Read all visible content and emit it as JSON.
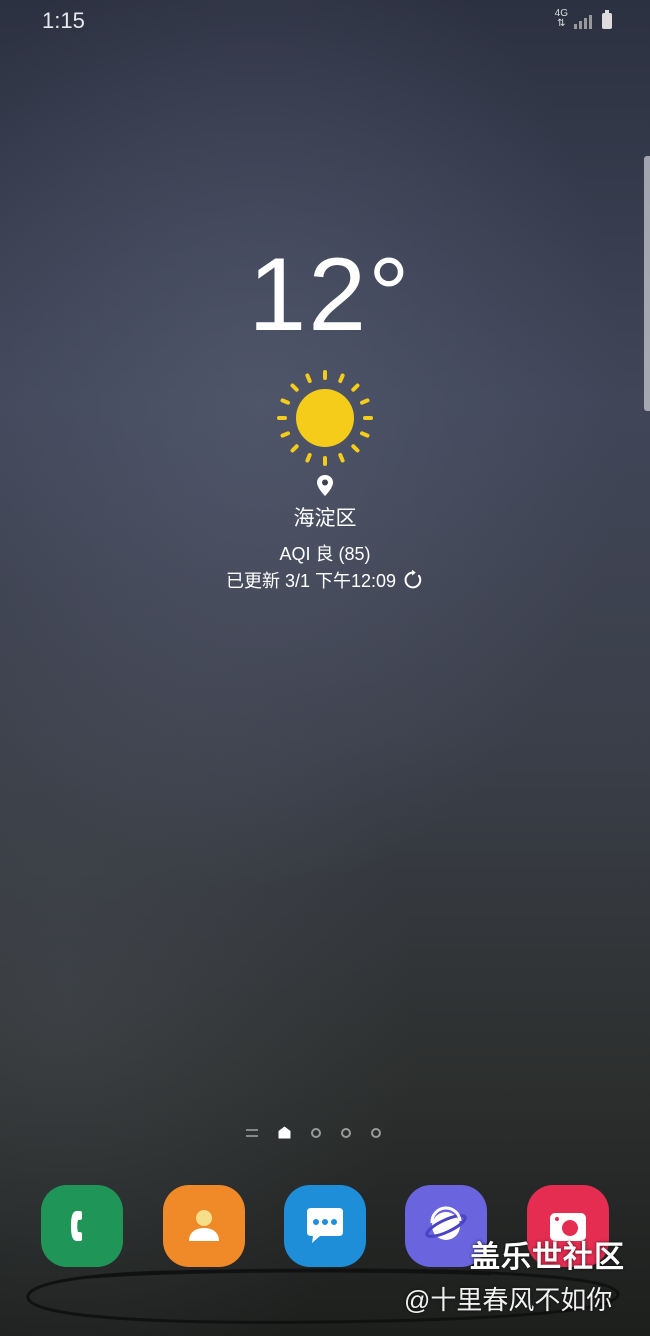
{
  "status_bar": {
    "time": "1:15",
    "network": "4G",
    "icons": [
      "data-arrows-icon",
      "signal-icon",
      "battery-icon"
    ]
  },
  "weather": {
    "temperature": "12°",
    "condition_icon": "sun-icon",
    "location_icon": "location-pin-icon",
    "location": "海淀区",
    "aqi": "AQI 良 (85)",
    "updated": "已更新 3/1 下午12:09",
    "refresh_icon": "refresh-icon",
    "sun_color": "#f5cc1a"
  },
  "page_indicator": {
    "pages": [
      "lines",
      "home",
      "dot",
      "dot",
      "dot"
    ],
    "active": "home"
  },
  "dock": {
    "apps": [
      {
        "name": "phone",
        "icon": "phone-icon",
        "color": "#1f9658"
      },
      {
        "name": "contacts",
        "icon": "contacts-icon",
        "color": "#f08928"
      },
      {
        "name": "messages",
        "icon": "messages-icon",
        "color": "#1f8ed8"
      },
      {
        "name": "internet",
        "icon": "internet-planet-icon",
        "color": "#6a64de"
      },
      {
        "name": "camera",
        "icon": "camera-icon",
        "color": "#e52d52"
      }
    ]
  },
  "watermark": {
    "title": "盖乐世社区",
    "user": "@十里春风不如你"
  }
}
